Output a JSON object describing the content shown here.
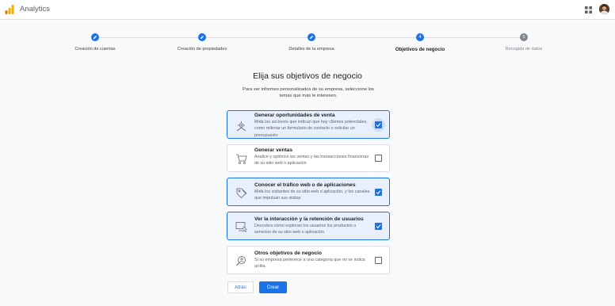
{
  "header": {
    "app_title": "Analytics",
    "logo_icon": "analytics-logo-icon",
    "apps_icon": "apps-grid-icon",
    "avatar_icon": "user-avatar"
  },
  "stepper": {
    "steps": [
      {
        "label": "Creación de cuentas",
        "state": "done",
        "number": ""
      },
      {
        "label": "Creación de propiedades",
        "state": "done",
        "number": ""
      },
      {
        "label": "Detalles de la empresa",
        "state": "done",
        "number": ""
      },
      {
        "label": "Objetivos de negocio",
        "state": "active",
        "number": "4"
      },
      {
        "label": "Recogida de datos",
        "state": "todo",
        "number": "5"
      }
    ]
  },
  "main": {
    "heading": "Elija sus objetivos de negocio",
    "subtext": "Para ver informes personalizados de su empresa, seleccione los temas que más le interesen.",
    "options": [
      {
        "title": "Generar oportunidades de venta",
        "description": "Mida las acciones que indican que hay clientes potenciales, como rellenar un formulario de contacto o solicitar un presupuesto",
        "checked": true,
        "icon": "target-lead-icon"
      },
      {
        "title": "Generar ventas",
        "description": "Analice y optimice las ventas y las transacciones financieras de su sitio web o aplicación",
        "checked": false,
        "icon": "shopping-cart-icon"
      },
      {
        "title": "Conocer el tráfico web o de aplicaciones",
        "description": "Mida los visitantes de su sitio web o aplicación, y los canales que impulsan sus visitas",
        "checked": true,
        "icon": "tag-icon"
      },
      {
        "title": "Ver la interacción y la retención de usuarios",
        "description": "Descubra cómo exploran los usuarios los productos o servicios de su sitio web o aplicación",
        "checked": true,
        "icon": "screen-cursor-icon"
      },
      {
        "title": "Otros objetivos de negocio",
        "description": "Si su empresa pertenece a una categoría que no se indica arriba",
        "checked": false,
        "icon": "magnifier-person-icon"
      }
    ]
  },
  "actions": {
    "back_label": "Atrás",
    "create_label": "Crear"
  },
  "colors": {
    "accent": "#1a73e8",
    "selected_bg": "#e8f0fe",
    "pending_step": "#80868b"
  }
}
